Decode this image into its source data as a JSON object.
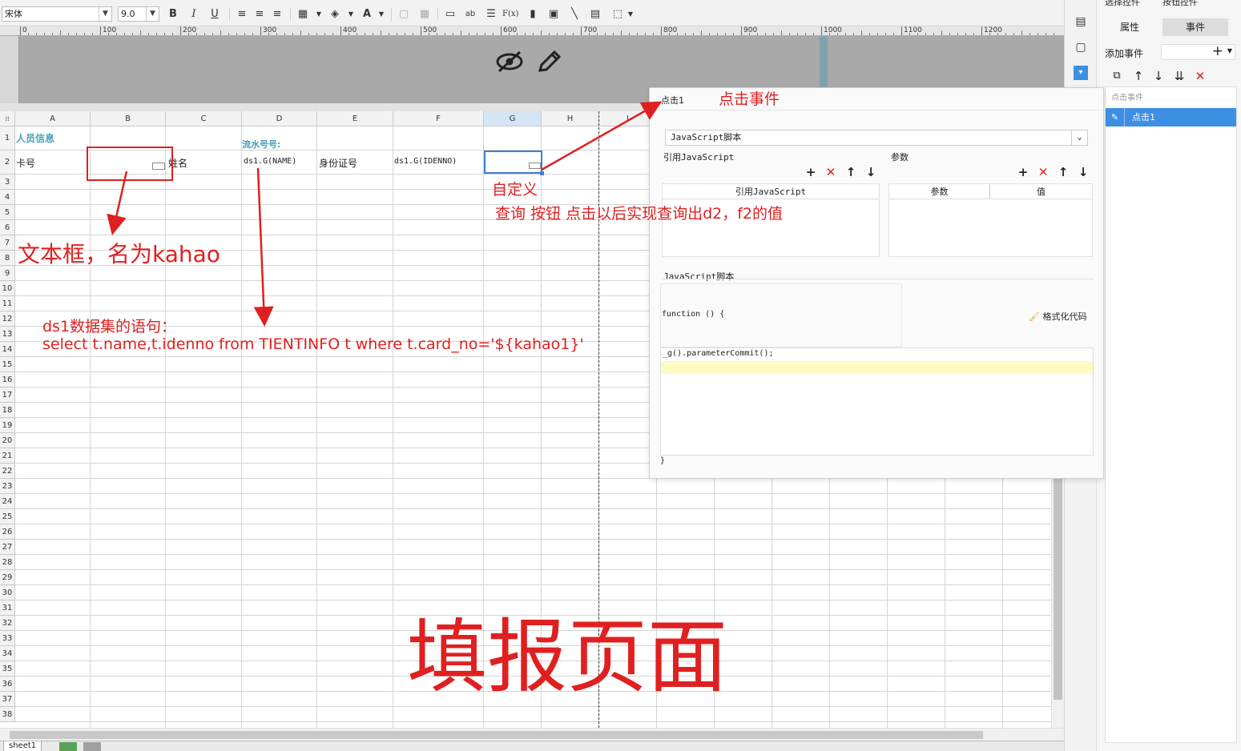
{
  "toolbar": {
    "font_name": "宋体",
    "font_size": "9.0",
    "bold": "B",
    "italic": "I",
    "underline": "U",
    "text_color": "A",
    "text_icon": "ab",
    "formula": "F(x)"
  },
  "ruler": {
    "labels": [
      "0",
      "100",
      "200",
      "300",
      "400",
      "500",
      "600",
      "700",
      "800",
      "900",
      "1000",
      "1100",
      "1200"
    ]
  },
  "grid": {
    "columns": [
      "A",
      "B",
      "C",
      "D",
      "E",
      "F",
      "G",
      "H",
      "I"
    ],
    "rows": [
      "1",
      "2",
      "3",
      "4",
      "5",
      "6",
      "7",
      "8",
      "9",
      "10",
      "11",
      "12",
      "13",
      "14",
      "15",
      "16",
      "17",
      "18",
      "19",
      "20",
      "21",
      "22",
      "23",
      "24",
      "25",
      "26",
      "27",
      "28",
      "29",
      "30",
      "31",
      "32",
      "33",
      "34",
      "35",
      "36",
      "37",
      "38"
    ],
    "cells": {
      "a1": "人员信息",
      "d1": "流水号号:",
      "a2": "卡号",
      "c2": "姓名",
      "d2": "ds1.G(NAME)",
      "e2": "身份证号",
      "f2": "ds1.G(IDENNO)"
    }
  },
  "sheet": {
    "tab": "sheet1"
  },
  "right_panel": {
    "top_tabs": [
      "选择控件",
      "按钮控件"
    ],
    "tabs": [
      "属性",
      "事件"
    ],
    "add_event_label": "添加事件",
    "list_header": "点击事件",
    "selected_event": "点击1"
  },
  "popup": {
    "title": "点击1",
    "script_type": "JavaScript脚本",
    "ref_js_label": "引用JavaScript",
    "params_label": "参数",
    "ref_js_col": "引用JavaScript",
    "param_col": "参数",
    "value_col": "值",
    "js_script_label": "JavaScript脚本",
    "function_open": "function () {",
    "format_code": "格式化代码",
    "code_line": "_g().parameterCommit();",
    "function_close": "}"
  },
  "annotations": {
    "click_event": "点击事件",
    "custom": "自定义",
    "query_desc": "查询 按钮 点击以后实现查询出d2，f2的值",
    "textbox_desc": "文本框，名为kahao",
    "ds1_title": "ds1数据集的语句：",
    "ds1_sql": "select t.name,t.idenno from TIENTINFO t where t.card_no='${kahao1}'",
    "big_title": "填报页面"
  },
  "colors": {
    "annotation": "#e02020",
    "selection_blue": "#3d8fe3",
    "header_teal": "#4aa0c0"
  }
}
